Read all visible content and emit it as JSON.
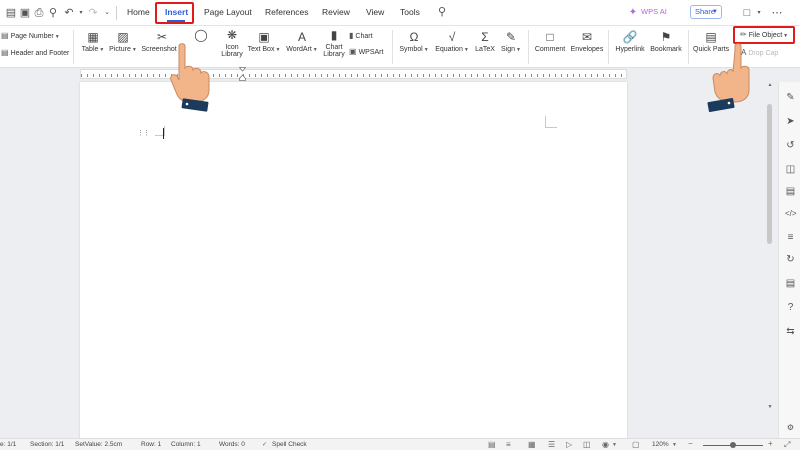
{
  "menubar": {
    "tabs": [
      "Home",
      "Insert",
      "Page Layout",
      "References",
      "Review",
      "View",
      "Tools"
    ],
    "active_tab": "Insert",
    "wps_ai_label": "WPS AI",
    "share_label": "Share"
  },
  "ribbon": {
    "page_number": "Page Number",
    "header_footer": "Header and Footer",
    "table": "Table",
    "picture": "Picture",
    "screenshot": "Screenshot",
    "icon_library_1": "Icon",
    "icon_library_2": "Library",
    "text_box": "Text Box",
    "wordart": "WordArt",
    "chart_library_1": "Chart",
    "chart_library_2": "Library",
    "chart": "Chart",
    "wpsart": "WPSArt",
    "symbol": "Symbol",
    "equation": "Equation",
    "latex": "LaTeX",
    "sign": "Sign",
    "comment": "Comment",
    "envelopes": "Envelopes",
    "hyperlink": "Hyperlink",
    "bookmark": "Bookmark",
    "quick_parts": "Quick Parts",
    "file_object": "File Object",
    "drop_cap": "Drop Cap"
  },
  "statusbar": {
    "page": "e: 1/1",
    "section": "Section: 1/1",
    "setvalue": "SetValue: 2.5cm",
    "row": "Row: 1",
    "column": "Column: 1",
    "words": "Words: 0",
    "spell_check": "Spell Check",
    "zoom": "120%"
  },
  "colors": {
    "accent": "#2b5fd9",
    "highlight": "#e01b1b",
    "wps_ai": "#b566d6"
  }
}
